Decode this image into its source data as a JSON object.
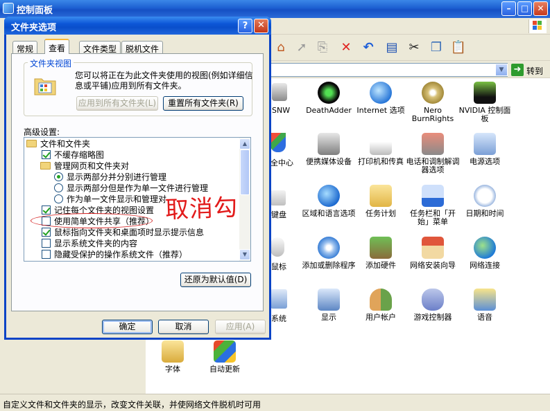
{
  "main_window": {
    "title": "控制面板",
    "goto_label": "转到",
    "status_text": "自定义文件和文件夹的显示，改变文件关联，并使网络文件脱机时可用"
  },
  "icons": {
    "truncated": [
      "SNW",
      "全中心",
      "键盘",
      "鼠标",
      "系统"
    ],
    "items": [
      {
        "label": "DeathAdder",
        "icon": "razer-icon"
      },
      {
        "label": "Internet 选项",
        "icon": "globe-check-icon"
      },
      {
        "label": "Nero BurnRights",
        "icon": "nero-disc-icon"
      },
      {
        "label": "NVIDIA 控制面板",
        "icon": "nvidia-icon"
      },
      {
        "label": "便携媒体设备",
        "icon": "media-device-icon"
      },
      {
        "label": "打印机和传真",
        "icon": "printer-icon"
      },
      {
        "label": "电话和调制解调器选项",
        "icon": "phone-icon"
      },
      {
        "label": "电源选项",
        "icon": "power-icon"
      },
      {
        "label": "区域和语言选项",
        "icon": "globe-icon"
      },
      {
        "label": "任务计划",
        "icon": "task-folder-icon"
      },
      {
        "label": "任务栏和「开始」菜单",
        "icon": "taskbar-icon"
      },
      {
        "label": "日期和时间",
        "icon": "clock-icon"
      },
      {
        "label": "添加或删除程序",
        "icon": "add-remove-icon"
      },
      {
        "label": "添加硬件",
        "icon": "hardware-icon"
      },
      {
        "label": "网络安装向导",
        "icon": "house-icon"
      },
      {
        "label": "网络连接",
        "icon": "network-icon"
      },
      {
        "label": "显示",
        "icon": "display-icon"
      },
      {
        "label": "用户帐户",
        "icon": "users-icon"
      },
      {
        "label": "游戏控制器",
        "icon": "gamepad-icon"
      },
      {
        "label": "语音",
        "icon": "speech-icon"
      },
      {
        "label": "字体",
        "icon": "font-folder-icon"
      },
      {
        "label": "自动更新",
        "icon": "windows-update-icon"
      }
    ]
  },
  "dialog": {
    "title": "文件夹选项",
    "tabs": [
      "常规",
      "查看",
      "文件类型",
      "脱机文件"
    ],
    "active_tab": "查看",
    "folder_view": {
      "group_label": "文件夹视图",
      "description": "您可以将正在为此文件夹使用的视图(例如详细信息或平铺)应用到所有文件夹。",
      "apply_all_button": "应用到所有文件夹(L)",
      "reset_all_button": "重置所有文件夹(R)"
    },
    "advanced_label": "高级设置:",
    "tree": [
      {
        "type": "folder",
        "text": "文件和文件夹",
        "indent": 0
      },
      {
        "type": "checkbox",
        "checked": true,
        "text": "不缓存缩略图",
        "indent": 1
      },
      {
        "type": "folder",
        "text": "管理网页和文件夹对",
        "indent": 1
      },
      {
        "type": "radio",
        "checked": true,
        "text": "显示两部分并分别进行管理",
        "indent": 2
      },
      {
        "type": "radio",
        "checked": false,
        "text": "显示两部分但是作为单一文件进行管理",
        "indent": 2
      },
      {
        "type": "radio",
        "checked": false,
        "text": "作为单一文件显示和管理对",
        "indent": 2
      },
      {
        "type": "checkbox",
        "checked": true,
        "text": "记住每个文件夹的视图设置",
        "indent": 1
      },
      {
        "type": "checkbox",
        "checked": false,
        "text": "使用简单文件共享（推荐）",
        "indent": 1
      },
      {
        "type": "checkbox",
        "checked": true,
        "text": "鼠标指向文件夹和桌面项时显示提示信息",
        "indent": 1
      },
      {
        "type": "checkbox",
        "checked": false,
        "text": "显示系统文件夹的内容",
        "indent": 1
      },
      {
        "type": "checkbox",
        "checked": false,
        "text": "隐藏受保护的操作系统文件（推荐）",
        "indent": 1
      }
    ],
    "restore_defaults_button": "还原为默认值(D)",
    "ok_button": "确定",
    "cancel_button": "取消",
    "apply_button": "应用(A)"
  },
  "annotation": {
    "text": "取消勾",
    "color": "#e21b1b"
  }
}
